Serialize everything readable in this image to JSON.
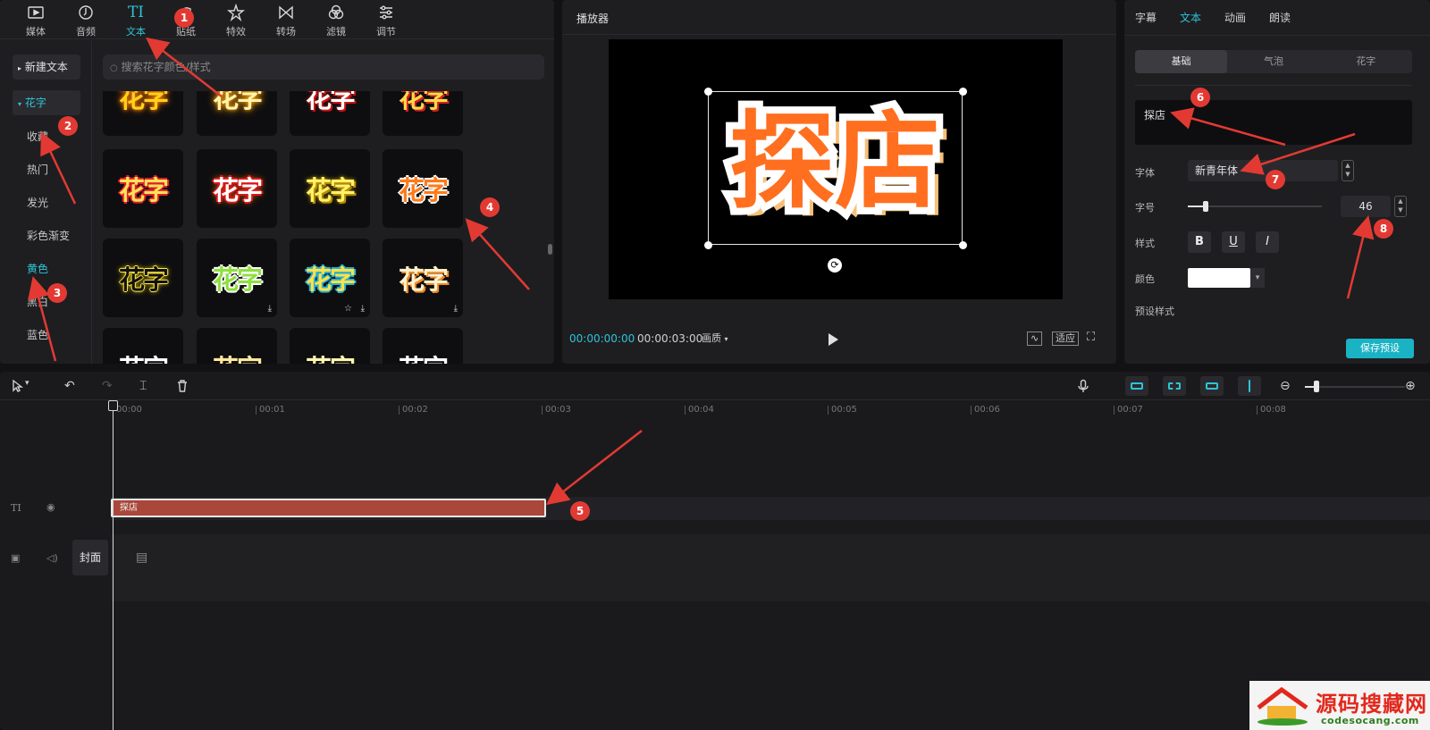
{
  "toolbar": {
    "tabs": [
      {
        "label": "媒体",
        "icon": "media-icon"
      },
      {
        "label": "音频",
        "icon": "audio-icon"
      },
      {
        "label": "文本",
        "icon": "text-icon",
        "glyph": "TI"
      },
      {
        "label": "贴纸",
        "icon": "sticker-icon"
      },
      {
        "label": "特效",
        "icon": "effects-icon"
      },
      {
        "label": "转场",
        "icon": "transition-icon"
      },
      {
        "label": "滤镜",
        "icon": "filter-icon"
      },
      {
        "label": "调节",
        "icon": "adjust-icon"
      }
    ]
  },
  "categories": {
    "new_text": "新建文本",
    "items": [
      "花字",
      "收藏",
      "热门",
      "发光",
      "彩色渐变",
      "黄色",
      "黑白",
      "蓝色"
    ]
  },
  "search": {
    "placeholder": "搜索花字颜色/样式"
  },
  "tiles": {
    "text": "花字"
  },
  "player": {
    "title": "播放器",
    "preview_text": "探店",
    "current_time": "00:00:00:00",
    "total_time": "00:00:03:00",
    "quality": "画质",
    "fit_label": "适应"
  },
  "inspector": {
    "tabs": [
      "字幕",
      "文本",
      "动画",
      "朗读"
    ],
    "segments": [
      "基础",
      "气泡",
      "花字"
    ],
    "text_value": "探店",
    "font_label": "字体",
    "font_value": "新青年体",
    "size_label": "字号",
    "size_value": "46",
    "size_fraction": 0.13,
    "style_label": "样式",
    "style_buttons": [
      "B",
      "U",
      "I"
    ],
    "color_label": "颜色",
    "color_value": "#ffffff",
    "preset_label": "预设样式",
    "save_preset": "保存预设"
  },
  "timeline": {
    "ruler": [
      "00:00",
      "00:01",
      "00:02",
      "00:03",
      "00:04",
      "00:05",
      "00:06",
      "00:07",
      "00:08"
    ],
    "text_clip": "探店",
    "cover_label": "封面",
    "text_track_glyph": "TI"
  },
  "annotations": [
    "1",
    "2",
    "3",
    "4",
    "5",
    "6",
    "7",
    "8"
  ],
  "watermark": {
    "title": "源码搜藏网",
    "url": "codesocang.com"
  },
  "colors": {
    "accent": "#2ec4d6",
    "clip": "#a9473b",
    "annotation": "#e23a33"
  }
}
